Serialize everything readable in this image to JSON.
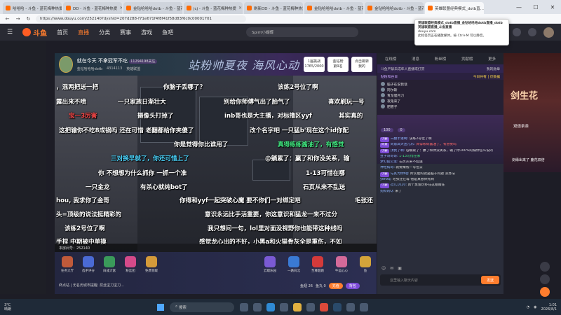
{
  "browser": {
    "tabs": [
      {
        "label": "哈哈哈 - 斗鱼 - 蓝花梅种热爱"
      },
      {
        "label": "DD - 斗鱼 - 蓝花梅种热爱"
      },
      {
        "label": "金钻哈哈哈dotb - 斗鱼 - 蓝花梅种热爱"
      },
      {
        "label": "jcj - 斗鱼 - 蓝花梅种热爱"
      },
      {
        "label": "刷新DD - 斗鱼 - 蓝花梅种热爱"
      },
      {
        "label": "金钻哈哈哈dotb - 斗鱼 - 蓝花梅种热爱"
      },
      {
        "label": "金钻哈哈哈dotb - 斗鱼 - 蓝花梅种热爱"
      },
      {
        "label": "英雄联盟经典模式_dotb直..."
      }
    ],
    "url": "https://www.douyu.com/252140?dyshid=207d288-f71e671f4f8f41f58d83f6c0c00001701",
    "popup": {
      "title": "英雄联盟经典模式_dotb直播_金钻哈哈哈dotb直播_dotb英雄联盟直播_斗鱼直播",
      "domain": "douyu.com",
      "body": "此标签页正在播放媒体。按 Ctrl+M 可以静音。"
    }
  },
  "header": {
    "logo": "斗鱼",
    "nav": [
      "首页",
      "直播",
      "分类",
      "赛事",
      "游戏",
      "鱼吧"
    ],
    "search_placeholder": "Spirit小蝴蝶"
  },
  "room": {
    "title": "就在今天 不拿冠军不吃",
    "badge": "11294198关注",
    "streamer": "金钻哈哈哈dotb",
    "room_id": "4314113",
    "category": "英雄联盟",
    "slogan": "站粉帅夏夜 海风心动",
    "badges": [
      {
        "top": "1届挑战",
        "bottom": "1765/2000"
      },
      {
        "top": "金钻榜",
        "bottom": "第9名"
      },
      {
        "top": "点击跳转",
        "bottom": "我的"
      }
    ]
  },
  "danmu": [
    {
      "text": "，混两把送一把",
      "color": "white"
    },
    {
      "text": "你脑子丢哪了？",
      "color": "white"
    },
    {
      "text": "该练2号位了啊",
      "color": "white"
    },
    {
      "text": "露出来不喷",
      "color": "white"
    },
    {
      "text": "一只家族日渐壮大",
      "color": "white"
    },
    {
      "text": "别给你师傅气出了胎气了",
      "color": "white"
    },
    {
      "text": "喜欢刷玩一号",
      "color": "white"
    },
    {
      "text": "宝一3厉害",
      "color": "red"
    },
    {
      "text": "摄像头打掉了",
      "color": "white"
    },
    {
      "text": "inb哥也是大主播，对标撸区yyf",
      "color": "white"
    },
    {
      "text": "其实真的",
      "color": "white"
    },
    {
      "text": "这把输你不吃8成锅吗 还在可惜 老翻都给你夹傻了",
      "color": "white"
    },
    {
      "text": "改个名字吧 一只猛b'现在这个id你配",
      "color": "white"
    },
    {
      "text": "你是觉得你比谁用了",
      "color": "white"
    },
    {
      "text": "真得练练酱油了，有感觉",
      "color": "green"
    },
    {
      "text": "三对换早就了，你还可惜上了",
      "color": "cyan"
    },
    {
      "text": "@躺累了：赢了和你没关系，输",
      "color": "white"
    },
    {
      "text": "你 不想想为什么抓你 一抓一个准",
      "color": "white"
    },
    {
      "text": "1-13可惜在哪",
      "color": "white"
    },
    {
      "text": "一只金龙",
      "color": "white"
    },
    {
      "text": "有杀心就纯bot了",
      "color": "white"
    },
    {
      "text": "石页从来不乱送",
      "color": "white"
    },
    {
      "text": "hou, 我求你了金哥",
      "color": "white"
    },
    {
      "text": "你得和yyf一起突破心魔 要不你们一对绑定吧",
      "color": "white"
    },
    {
      "text": "毛张还",
      "color": "white"
    },
    {
      "text": "头=顶级的说法挺精彩的",
      "color": "white"
    },
    {
      "text": "意识永远比手活重要，你这意识和猛龙一来不过分",
      "color": "white"
    },
    {
      "text": "该练2号位了啊",
      "color": "white"
    },
    {
      "text": "我只想问一句，lol里对面没视野你也能带这种线吗",
      "color": "white"
    },
    {
      "text": "手捏 中期被中单摸",
      "color": "white"
    },
    {
      "text": "感觉龙心出的不好，小黑a和火猫骨灰全是重伤，不如",
      "color": "white"
    }
  ],
  "video": {
    "status": "本房间号：252140"
  },
  "gifts": {
    "left": [
      "任务大厅",
      "选手评分",
      "白成大富",
      "粉丝团",
      "免费领取"
    ],
    "right": [
      "云端乐园",
      "一路向北",
      "至尊超跑",
      "牛运心心",
      "鱼",
      "出征鞭"
    ],
    "fans_text": "终点站 | 无名氏城市提醒: 屌丝宝刀宝刀...",
    "balance_label": "鱼翅 26",
    "balance2_label": "鱼丸 0",
    "charge_btn": "充值",
    "bag_btn": "背包"
  },
  "chat": {
    "tabs": [
      "在线榜",
      "消息",
      "粉丝榜",
      "贡献榜",
      "更多"
    ],
    "sub_left": "斗鱼严禁未成年人直播或打赏",
    "sub_right": "我的勋章",
    "rank_label": "贴粉和谷日",
    "rank_today": "今日共有 | 仅数据",
    "ranks": [
      "脑子在说我话",
      "阿尔斯",
      "青龙偃月刀",
      "夜鬼来了",
      "肥肥子"
    ],
    "count1": "100",
    "count2": "0",
    "messages": [
      {
        "name": "三翻丰进啊:",
        "text": "该练2号位了啊"
      },
      {
        "name": "同意高大丞儿乐:",
        "text": "真得练练酱油了。有感觉吗"
      },
      {
        "name": "顶我了啊:",
        "text": "@躺累了：赢了和你没关系，输了你100%的锅你怎么说的"
      },
      {
        "name": "豆子哥哥哥:",
        "text": "1-13可惜在哪"
      },
      {
        "name": "梦幻狐公主:",
        "text": "石页从来不乱送"
      },
      {
        "name": "神经病哥:",
        "text": "就要赚钱一号位去"
      },
      {
        "name": "与其为你8g:",
        "text": "所实能的就是脑子问题 没办法"
      },
      {
        "name": "yehxq:",
        "text": "毛张还在等 他是真想你死啊"
      },
      {
        "name": "过儿1020:",
        "text": "真个臭鱼烂虾在这瞎瞎狂"
      },
      {
        "name": "狗狗的Q:",
        "text": "来了"
      }
    ],
    "input_placeholder": "这里输入聊天内容",
    "send_label": "发送"
  },
  "promo": {
    "title": "剑生花",
    "subtitle": "双倍亲亲",
    "caption": "剑缘出来了 鹿花双倍"
  },
  "taskbar": {
    "weather_temp": "3°C",
    "weather_desc": "晴朗",
    "search_label": "搜索",
    "time": "1:01",
    "date": "2026/8/1"
  }
}
